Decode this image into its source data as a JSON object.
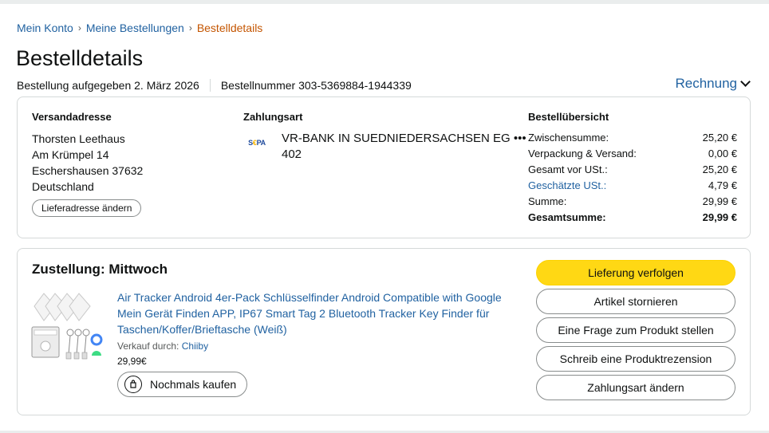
{
  "breadcrumb": {
    "items": [
      "Mein Konto",
      "Meine Bestellungen"
    ],
    "current": "Bestelldetails",
    "separator": "›"
  },
  "page_title": "Bestelldetails",
  "order": {
    "placed": "Bestellung aufgegeben 2. März 2026",
    "number": "Bestellnummer 303-5369884-1944339",
    "invoice_label": "Rechnung"
  },
  "shipping": {
    "title": "Versandadresse",
    "lines": [
      "Thorsten Leethaus",
      "Am Krümpel 14",
      "Eschershausen 37632",
      "Deutschland"
    ],
    "change_button": "Lieferadresse ändern"
  },
  "payment": {
    "title": "Zahlungsart",
    "icon": "sepa-icon",
    "icon_text": "SEPA",
    "method": "VR-BANK IN SUEDNIEDERSACHSEN EG ••• 402"
  },
  "summary": {
    "title": "Bestellübersicht",
    "rows": [
      {
        "label": "Zwischensumme:",
        "value": "25,20 €"
      },
      {
        "label": "Verpackung & Versand:",
        "value": "0,00 €"
      },
      {
        "label": "Gesamt vor USt.:",
        "value": "25,20 €"
      },
      {
        "label": "Geschätzte USt.:",
        "value": "4,79 €"
      },
      {
        "label": "Summe:",
        "value": "29,99 €"
      },
      {
        "label": "Gesamtsumme:",
        "value": "29,99 €"
      }
    ]
  },
  "delivery": {
    "title": "Zustellung: Mittwoch",
    "product": {
      "title": "Air Tracker Android 4er-Pack Schlüsselfinder Android Compatible with Google Mein Gerät Finden APP, IP67 Smart Tag 2 Bluetooth Tracker Key Finder für Taschen/Koffer/Brieftasche (Weiß)",
      "seller_label": "Verkauf durch:",
      "seller": "Chiiby",
      "price": "29,99€",
      "buy_again": "Nochmals kaufen"
    },
    "actions": [
      "Lieferung verfolgen",
      "Artikel stornieren",
      "Eine Frage zum Produkt stellen",
      "Schreib eine Produktrezension",
      "Zahlungsart ändern"
    ]
  },
  "colors": {
    "link": "#2162a1",
    "breadcrumb_current": "#c45500",
    "primary_button": "#ffd814"
  }
}
